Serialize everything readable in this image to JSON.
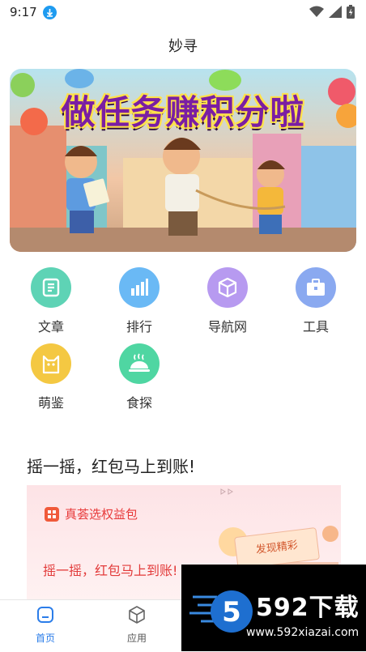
{
  "status_bar": {
    "time": "9:17"
  },
  "header": {
    "title": "妙寻"
  },
  "banner": {
    "title": "做任务赚积分啦"
  },
  "grid": {
    "items": [
      {
        "label": "文章",
        "icon": "article-icon",
        "color": "#5ed3b5"
      },
      {
        "label": "排行",
        "icon": "ranking-icon",
        "color": "#6ab9f5"
      },
      {
        "label": "导航网",
        "icon": "box-icon",
        "color": "#b79af0"
      },
      {
        "label": "工具",
        "icon": "toolbox-icon",
        "color": "#8aa9f0"
      },
      {
        "label": "萌鉴",
        "icon": "cat-icon",
        "color": "#f4c842"
      },
      {
        "label": "食探",
        "icon": "food-icon",
        "color": "#4fd6a2"
      }
    ]
  },
  "section": {
    "title": "摇一摇，红包马上到账!"
  },
  "promo": {
    "brand": "真荟选权益包",
    "slogan": "摇一摇，红包马上到账!",
    "card_text": "发现精彩"
  },
  "tabbar": {
    "items": [
      {
        "label": "首页",
        "icon": "home-icon",
        "active": true
      },
      {
        "label": "应用",
        "icon": "cube-icon",
        "active": false
      }
    ],
    "active_color": "#2b7de9"
  },
  "watermark": {
    "brand": "592下载",
    "url": "www.592xiazai.com"
  }
}
